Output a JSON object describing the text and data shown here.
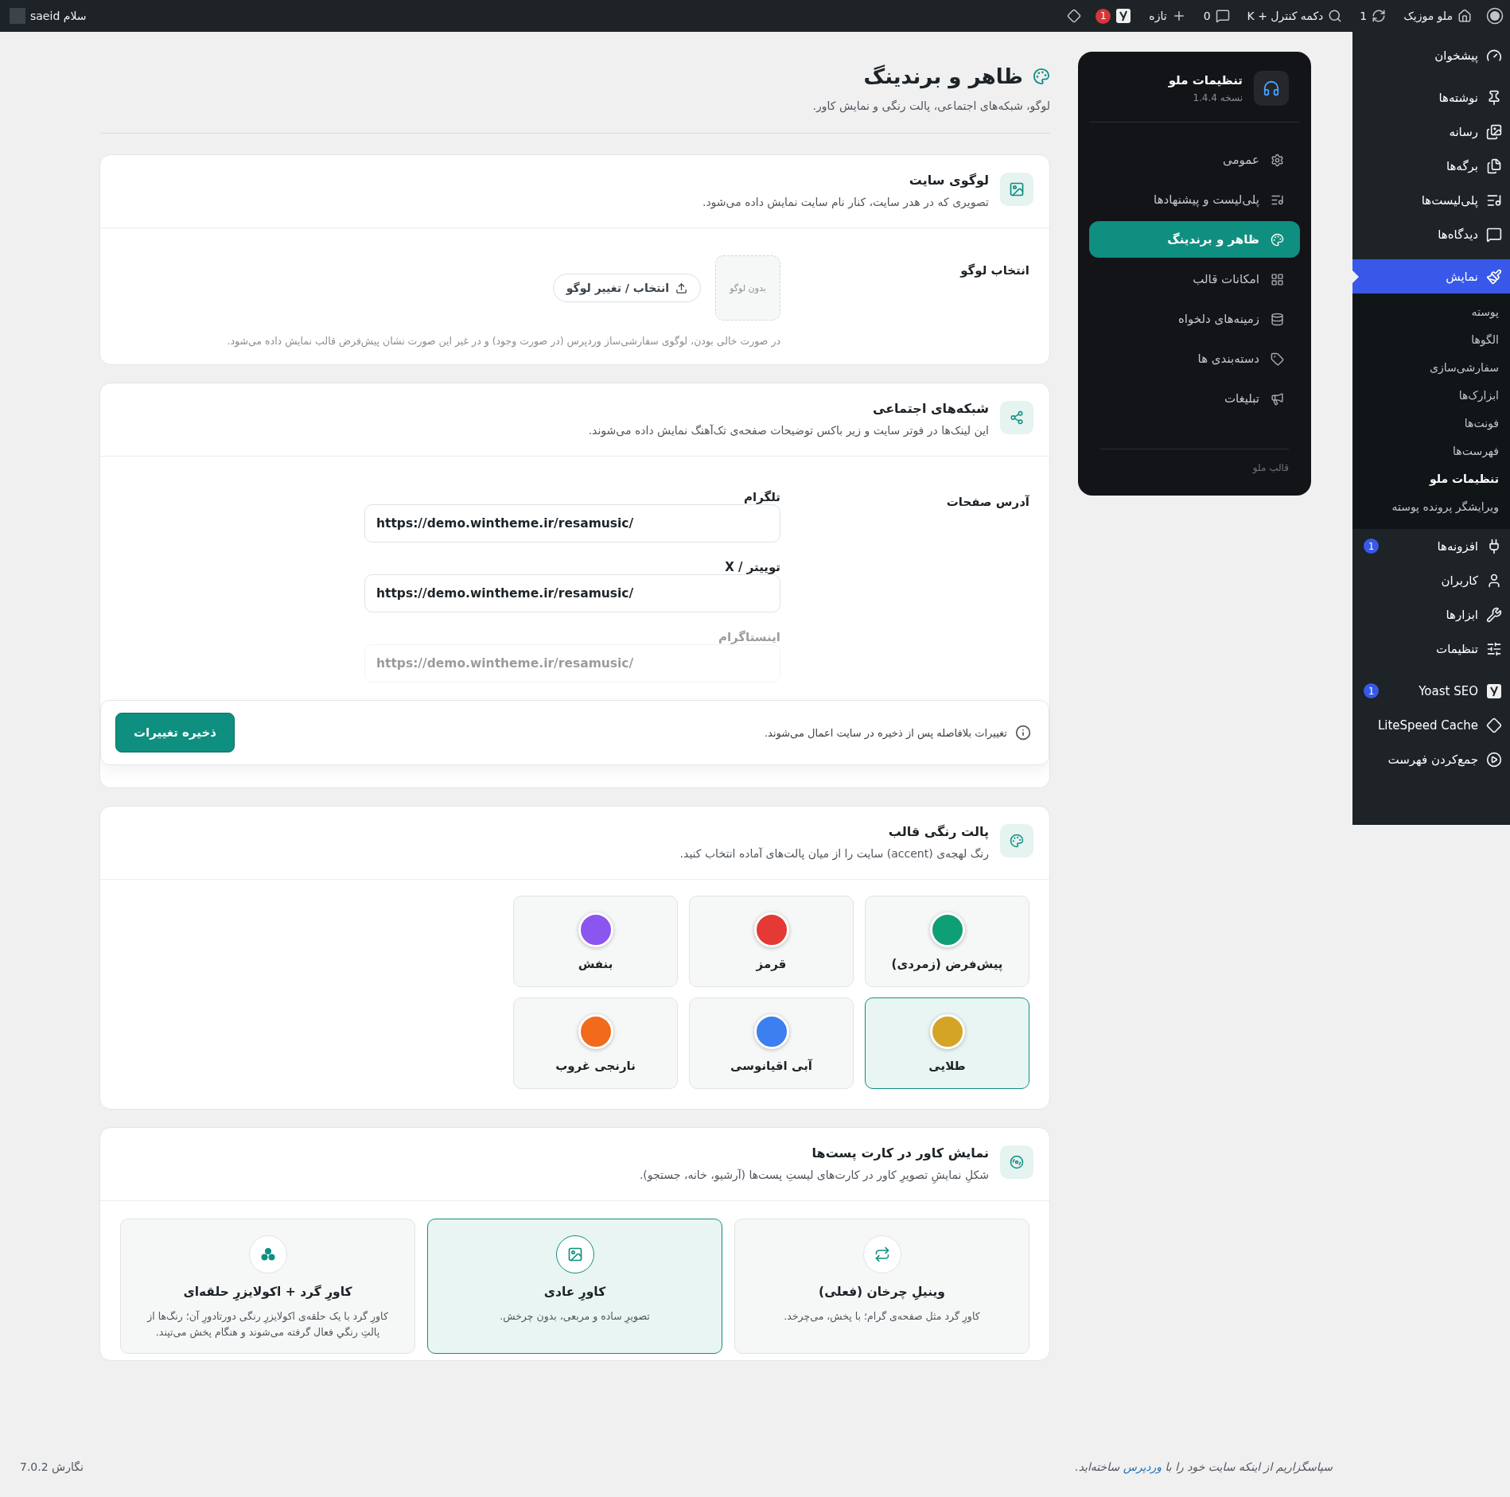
{
  "top_bar": {
    "site_name": "ملو موزیک",
    "updates": "1",
    "search_shortcut": "دکمه کنترل + K",
    "comments": "0",
    "new_label": "تازه",
    "seo_badge": "1",
    "greeting": "سلام saeid"
  },
  "admin_menu": {
    "groups": [
      [
        {
          "label": "پیشخوان",
          "selected": false
        }
      ],
      [
        {
          "label": "نوشته‌ها",
          "selected": false
        },
        {
          "label": "رسانه",
          "selected": false
        },
        {
          "label": "برگه‌ها",
          "selected": false
        },
        {
          "label": "پلی‌لیست‌ها",
          "selected": false
        },
        {
          "label": "دیدگاه‌ها",
          "selected": false
        }
      ],
      [
        {
          "label": "نمایش",
          "selected": true,
          "children": [
            {
              "label": "پوسته",
              "selected": false
            },
            {
              "label": "الگوها",
              "selected": false
            },
            {
              "label": "سفارشی‌سازی",
              "selected": false
            },
            {
              "label": "ابزارک‌ها",
              "selected": false
            },
            {
              "label": "فونت‌ها",
              "selected": false
            },
            {
              "label": "فهرست‌ها",
              "selected": false
            },
            {
              "label": "تنظیمات ملو",
              "selected": true
            },
            {
              "label": "ویرایشگر پرونده پوسته",
              "selected": false
            }
          ]
        },
        {
          "label": "افزونه‌ها",
          "selected": false,
          "badge": "1"
        },
        {
          "label": "کاربران",
          "selected": false
        },
        {
          "label": "ابزارها",
          "selected": false
        },
        {
          "label": "تنظیمات",
          "selected": false
        }
      ],
      [
        {
          "label": "Yoast SEO",
          "selected": false,
          "badge": "1"
        },
        {
          "label": "LiteSpeed Cache",
          "selected": false
        },
        {
          "label": "جمع‌کردن فهرست",
          "selected": false
        }
      ]
    ]
  },
  "settings_nav": {
    "title": "تنظیمات ملو",
    "version": "نسخه 1.4.4",
    "items": [
      {
        "label": "عمومی",
        "selected": false
      },
      {
        "label": "پلی‌لیست و پیشنهادها",
        "selected": false
      },
      {
        "label": "ظاهر و برندینگ",
        "selected": true
      },
      {
        "label": "امکانات قالب",
        "selected": false
      },
      {
        "label": "زمینه‌های دلخواه",
        "selected": false
      },
      {
        "label": "دسته‌بندی ها",
        "selected": false
      },
      {
        "label": "تبلیغات",
        "selected": false
      }
    ],
    "footer": "قالب ملو"
  },
  "page": {
    "title": "ظاهر و برندینگ",
    "subtitle": "لوگو، شبکه‌های اجتماعی، پالت رنگی و نمایش کاور."
  },
  "logo_card": {
    "title": "لوگوی سایت",
    "description": "تصویری که در هدر سایت، کنار نام سایت نمایش داده می‌شود.",
    "field_label": "انتخاب لوگو",
    "empty_text": "بدون لوگو",
    "button": "انتخاب / تغییر لوگو",
    "help": "در صورت خالی بودن، لوگوی سفارشی‌ساز وردپرس (در صورت وجود) و در غیر این صورت نشان پیش‌فرض قالب نمایش داده می‌شود."
  },
  "social_card": {
    "title": "شبکه‌های اجتماعی",
    "description": "این لینک‌ها در فوتر سایت و زیر باکس توضیحات صفحه‌ی تک‌آهنگ نمایش داده می‌شوند.",
    "field_label": "آدرس صفحات",
    "links": [
      {
        "label": "تلگرام",
        "value": "https://demo.wintheme.ir/resamusic/"
      },
      {
        "label": "توییتر / X",
        "value": "https://demo.wintheme.ir/resamusic/"
      },
      {
        "label": "اینستاگرام",
        "value": "https://demo.wintheme.ir/resamusic/"
      }
    ]
  },
  "save_bar": {
    "note": "تغییرات بلافاصله پس از ذخیره در سایت اعمال می‌شوند.",
    "button": "ذخیره تغییرات"
  },
  "palette_card": {
    "title": "پالت رنگی قالب",
    "description": "رنگ لهجه‌ی (accent) سایت را از میان پالت‌های آماده انتخاب کنید.",
    "options": [
      {
        "name": "پیش‌فرض (زمردی)",
        "color": "#0f9f76",
        "selected": false
      },
      {
        "name": "قرمز",
        "color": "#e53935",
        "selected": false
      },
      {
        "name": "بنفش",
        "color": "#8b55f0",
        "selected": false
      },
      {
        "name": "طلایی",
        "color": "#d4a427",
        "selected": true
      },
      {
        "name": "آبی اقیانوسی",
        "color": "#3b7ff0",
        "selected": false
      },
      {
        "name": "نارنجی غروب",
        "color": "#f26b1d",
        "selected": false
      }
    ]
  },
  "cover_card": {
    "title": "نمایش کاور در کارت پست‌ها",
    "description": "شکلِ نمایشِ تصویرِ کاور در کارت‌های لیستِ پست‌ها (آرشیو، خانه، جستجو).",
    "options": [
      {
        "title": "وینیلِ چرخان (فعلی)",
        "description": "کاورِ گرد مثل صفحه‌ی گرام؛ با پخش، می‌چرخد.",
        "selected": false
      },
      {
        "title": "کاورِ عادی",
        "description": "تصویرِ ساده و مربعی، بدون چرخش.",
        "selected": true
      },
      {
        "title": "کاورِ گرد + اکولایزرِ حلقه‌ای",
        "description": "کاورِ گرد با یک حلقه‌ی اکولایزرِ رنگی دورتادورِ آن؛ رنگ‌ها از پالتِ رنگیِ فعال گرفته می‌شوند و هنگام پخش می‌تپند.",
        "selected": false
      }
    ]
  },
  "footer": {
    "thanks_before": "سپاسگزاریم از اینکه سایت خود را با",
    "link": "وردپرس",
    "thanks_after": "ساخته‌اید.",
    "version": "نگارش 7.0.2"
  }
}
